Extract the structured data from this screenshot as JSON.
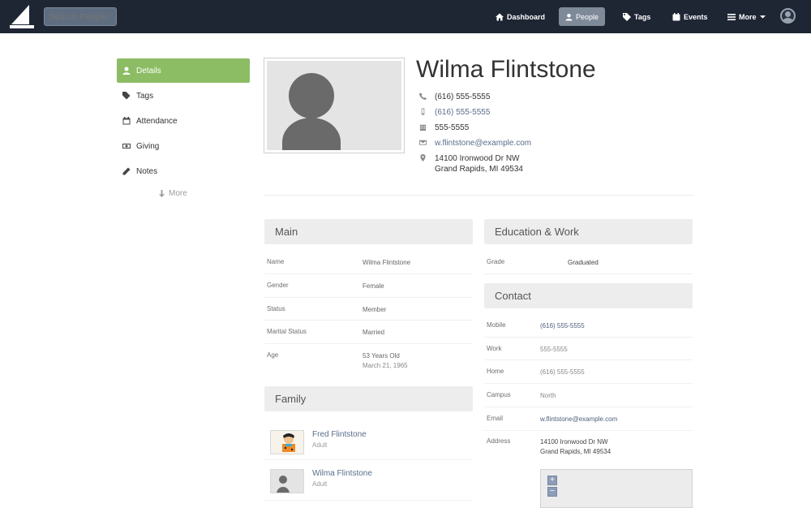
{
  "nav": {
    "search_placeholder": "Search People...",
    "items": [
      {
        "label": "Dashboard"
      },
      {
        "label": "People"
      },
      {
        "label": "Tags"
      },
      {
        "label": "Events"
      },
      {
        "label": "More"
      }
    ]
  },
  "sidebar": {
    "items": [
      {
        "label": "Details"
      },
      {
        "label": "Tags"
      },
      {
        "label": "Attendance"
      },
      {
        "label": "Giving"
      },
      {
        "label": "Notes"
      }
    ],
    "more_label": "More"
  },
  "person": {
    "name": "Wilma Flintstone",
    "mobile": "(616) 555-5555",
    "home": "(616) 555-5555",
    "work": "555-5555",
    "email": "w.flintstone@example.com",
    "address_line1": "14100 Ironwood Dr NW",
    "address_line2": "Grand Rapids, MI 49534"
  },
  "main": {
    "title": "Main",
    "rows": [
      {
        "label": "Name",
        "value": "Wilma Flintstone"
      },
      {
        "label": "Gender",
        "value": "Female"
      },
      {
        "label": "Status",
        "value": "Member"
      },
      {
        "label": "Marital Status",
        "value": "Married"
      },
      {
        "label": "Age",
        "value": "53 Years Old",
        "sub": "March 21, 1965"
      }
    ]
  },
  "family": {
    "title": "Family",
    "members": [
      {
        "name": "Fred Flintstone",
        "role": "Adult"
      },
      {
        "name": "Wilma Flintstone",
        "role": "Adult"
      }
    ]
  },
  "education": {
    "title": "Education & Work",
    "rows": [
      {
        "label": "Grade",
        "value": "Graduated"
      }
    ]
  },
  "contact": {
    "title": "Contact",
    "rows": [
      {
        "label": "Mobile",
        "value": "(616) 555-5555"
      },
      {
        "label": "Work",
        "value": "555-5555"
      },
      {
        "label": "Home",
        "value": "(616) 555-5555"
      },
      {
        "label": "Campus",
        "value": "North"
      },
      {
        "label": "Email",
        "value": "w.flintstone@example.com"
      },
      {
        "label": "Address",
        "value": "14100 Ironwood Dr NW",
        "value2": "Grand Rapids, MI 49534"
      }
    ]
  },
  "map": {
    "zoom_in": "+",
    "zoom_out": "−"
  }
}
